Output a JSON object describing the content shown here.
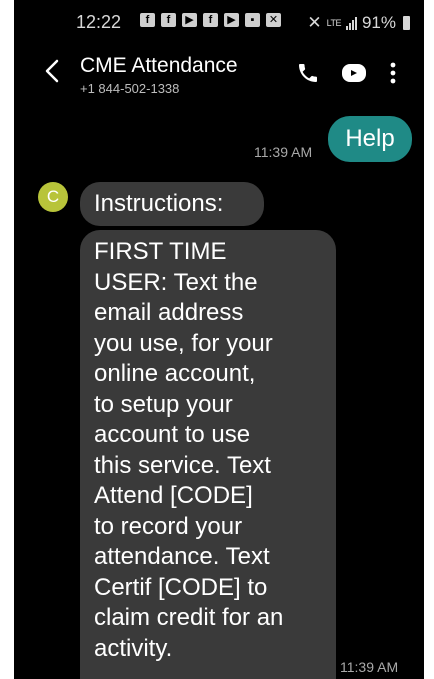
{
  "status_bar": {
    "time": "12:22",
    "network": "LTE",
    "battery": "91%",
    "app_icons": [
      "facebook-icon",
      "facebook-icon",
      "youtube-icon",
      "facebook-icon",
      "youtube-icon",
      "gallery-icon",
      "vpn-icon"
    ]
  },
  "header": {
    "contact_name": "CME Attendance",
    "contact_number": "+1 844-502-1338"
  },
  "messages": {
    "sent": {
      "text": "Help",
      "time": "11:39 AM"
    },
    "received": {
      "avatar_letter": "C",
      "first": "Instructions:",
      "body": "FIRST TIME\nUSER: Text the\nemail address\nyou use, for your\nonline account,\nto setup your\naccount to use\nthis service. Text\nAttend [CODE]\nto record your\nattendance. Text\nCertif [CODE] to\nclaim credit for an\nactivity.",
      "time": "11:39 AM"
    }
  },
  "colors": {
    "background": "#000000",
    "sent_bubble": "#1f8a86",
    "received_bubble": "#3a3a3a",
    "avatar": "#b8c43a"
  }
}
